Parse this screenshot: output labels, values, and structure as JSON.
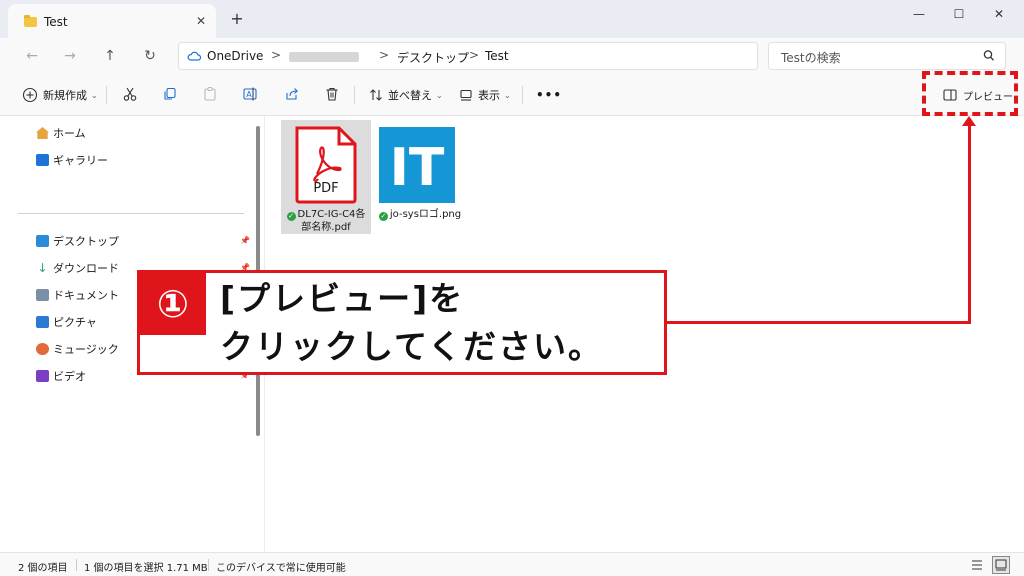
{
  "window": {
    "tab_title": "Test",
    "tab_close": "✕",
    "tab_add": "+",
    "minimize": "—",
    "maximize": "☐",
    "close": "✕"
  },
  "nav": {
    "back": "←",
    "forward": "→",
    "up": "↑",
    "refresh": "↻",
    "breadcrumb": [
      "OneDrive",
      "",
      "デスクトップ",
      "Test"
    ],
    "separator": ">",
    "search_placeholder": "Testの検索"
  },
  "toolbar": {
    "new_label": "新規作成",
    "sort_label": "並べ替え",
    "view_label": "表示",
    "more_label": "•••",
    "preview_label": "プレビュー"
  },
  "sidebar": {
    "top_items": [
      {
        "label": "ホーム",
        "icon": "home-icon",
        "color": "#e8a33d"
      },
      {
        "label": "ギャラリー",
        "icon": "gallery-icon",
        "color": "#1e73d8"
      }
    ],
    "pinned_items": [
      {
        "label": "デスクトップ",
        "icon": "desktop-icon",
        "color": "#2b8bd8"
      },
      {
        "label": "ダウンロード",
        "icon": "download-icon",
        "color": "#2a9d8f"
      },
      {
        "label": "ドキュメント",
        "icon": "document-icon",
        "color": "#7a8fa8"
      },
      {
        "label": "ピクチャ",
        "icon": "pictures-icon",
        "color": "#2a7ad4"
      },
      {
        "label": "ミュージック",
        "icon": "music-icon",
        "color": "#e2693b"
      },
      {
        "label": "ビデオ",
        "icon": "video-icon",
        "color": "#7b3fc4"
      }
    ]
  },
  "files": [
    {
      "name_line1": "DL7C-IG-C4各",
      "name_line2": "部名称.pdf",
      "icon": "pdf-icon",
      "icon_text": "PDF",
      "selected": true
    },
    {
      "name_line1": "jo-sysロゴ.png",
      "name_line2": "",
      "icon": "image-icon",
      "icon_text": "IT",
      "selected": false
    }
  ],
  "status": {
    "item_count": "2 個の項目",
    "selected": "1 個の項目を選択  1.71 MB",
    "availability": "このデバイスで常に使用可能"
  },
  "callout": {
    "number": "①",
    "line1": "[プレビュー]を",
    "line2": "クリックしてください。"
  },
  "colors": {
    "accent_red": "#e0141b",
    "pdf_red": "#e0141b",
    "it_blue": "#1497d4",
    "sync_green": "#2ea043"
  }
}
